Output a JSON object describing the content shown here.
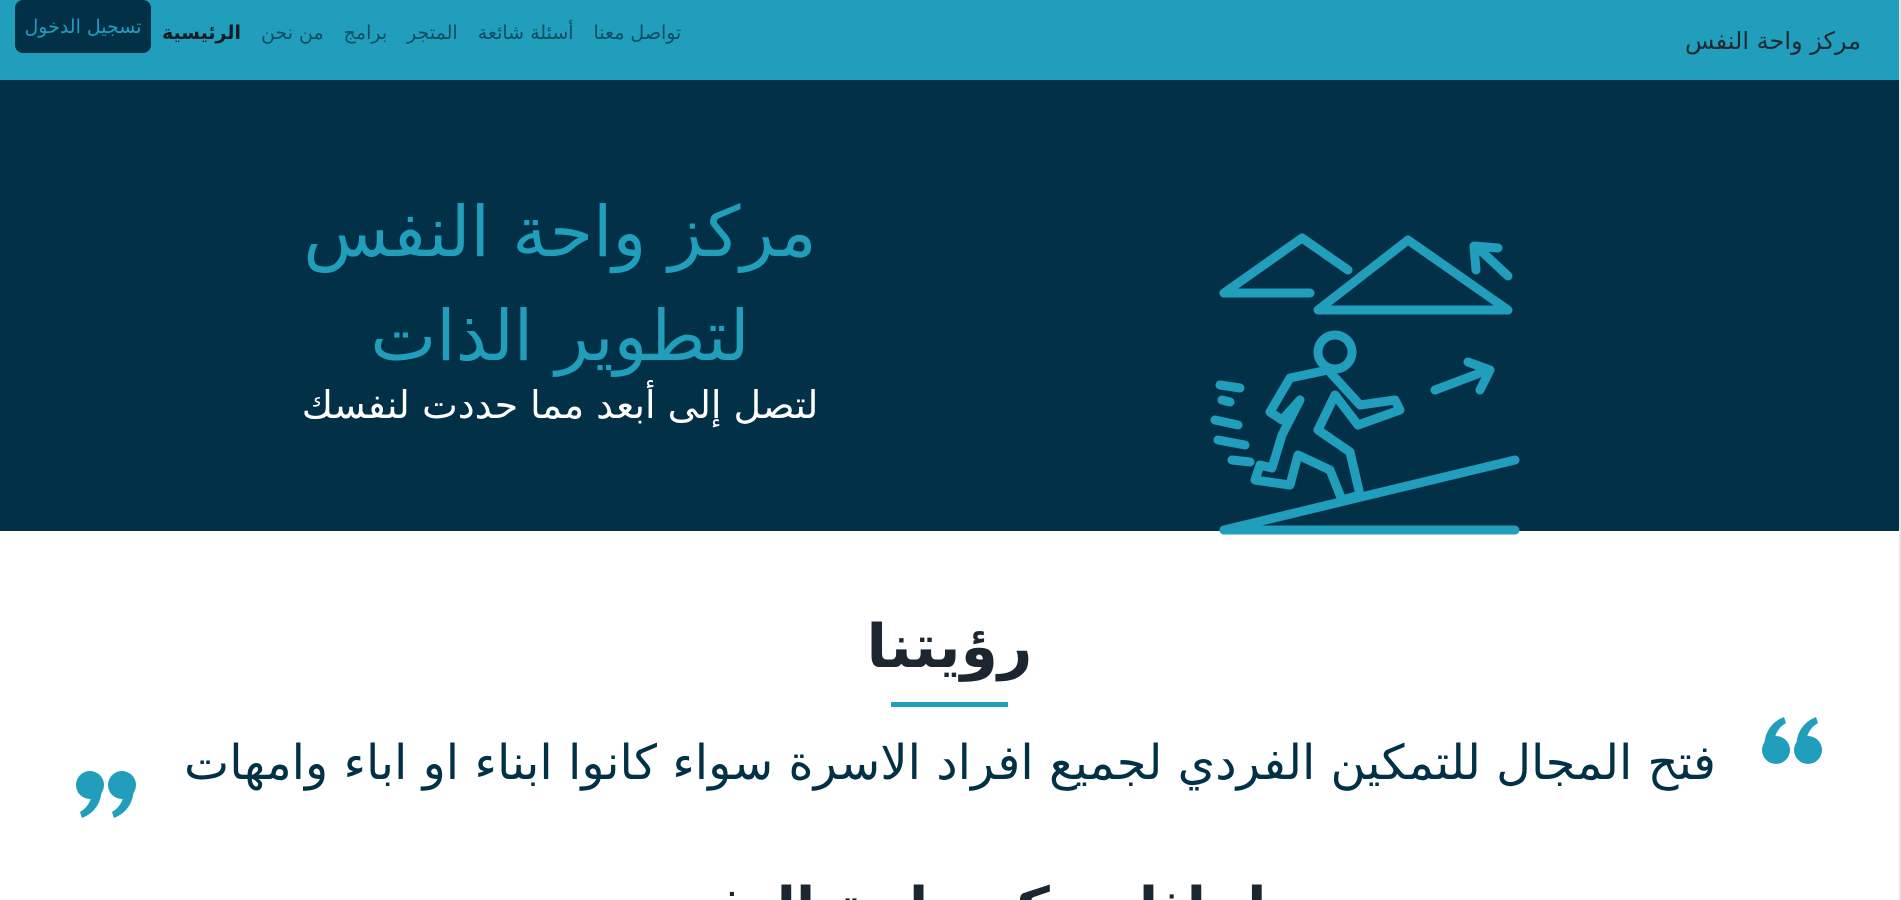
{
  "navbar": {
    "brand": "مركز واحة النفس",
    "links": [
      {
        "label": "الرئيسية",
        "active": true
      },
      {
        "label": "من نحن",
        "active": false
      },
      {
        "label": "برامج",
        "active": false
      },
      {
        "label": "المتجر",
        "active": false
      },
      {
        "label": "أسئلة شائعة",
        "active": false
      },
      {
        "label": "تواصل معنا",
        "active": false
      }
    ],
    "login_label": "تسجيل الدخول"
  },
  "hero": {
    "title_line1": "مركز واحة النفس",
    "title_line2": "لتطوير الذات",
    "subtitle": "لتصل إلى أبعد مما حددت لنفسك",
    "illustration": "person-climbing-icon"
  },
  "vision": {
    "heading": "رؤيتنا",
    "quote": "فتح المجال للتمكين الفردي لجميع افراد الاسرة سواء كانوا ابناء او اباء وامهات",
    "quote_open_icon": "quote-open-icon",
    "quote_close_icon": "quote-close-icon"
  },
  "next_section": {
    "heading": "لماذا مركز واحة النفس"
  },
  "colors": {
    "accent": "#219ebc",
    "dark": "#023047",
    "text": "#1b2631"
  }
}
